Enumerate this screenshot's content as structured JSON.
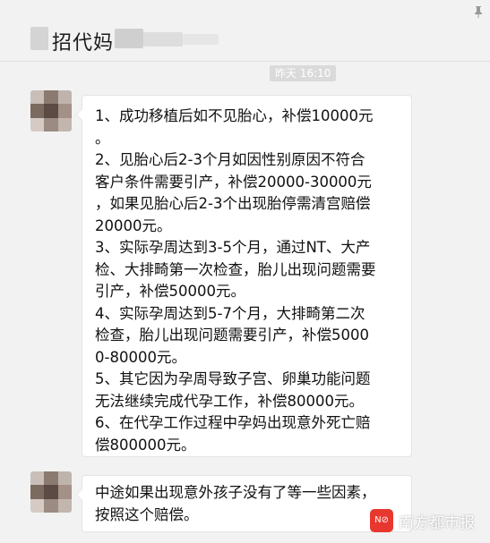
{
  "header": {
    "title": "招代妈",
    "pin_icon": "pin-icon"
  },
  "timestamp": "昨天 16:10",
  "messages": [
    {
      "lines": [
        "1、成功移植后如不见胎心，补偿10000元",
        "。",
        "2、见胎心后2-3个月如因性别原因不符合",
        "客户条件需要引产，补偿20000-30000元",
        "，如果见胎心后2-3个出现胎停需清宫赔偿",
        "20000元。",
        "3、实际孕周达到3-5个月，通过NT、大产",
        "检、大排畸第一次检查，胎儿出现问题需要",
        "引产，补偿50000元。",
        "4、实际孕周达到5-7个月，大排畸第二次",
        "检查，胎儿出现问题需要引产，补偿5000",
        "0-80000元。",
        "5、其它因为孕周导致子宫、卵巢功能问题",
        "无法继续完成代孕工作，补偿80000元。",
        "6、在代孕工作过程中孕妈出现意外死亡赔",
        "偿800000元。"
      ]
    },
    {
      "lines": [
        "中途如果出现意外孩子没有了等一些因素，",
        "按照这个赔偿。"
      ]
    }
  ],
  "watermark": {
    "logo_text": "N⊘",
    "text": "南方都市报"
  }
}
